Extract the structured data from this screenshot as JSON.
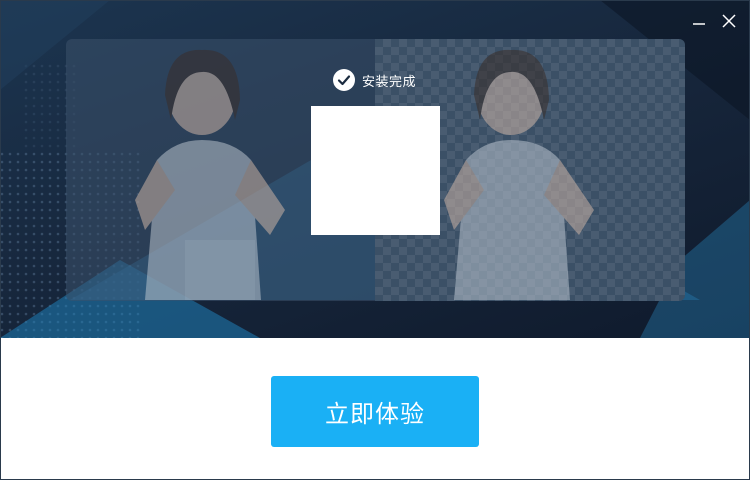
{
  "window": {
    "minimize_icon": "minimize-icon",
    "close_icon": "close-icon"
  },
  "status": {
    "text": "安装完成",
    "icon": "check-circle-icon"
  },
  "preview": {
    "left_label": "original-photo",
    "right_label": "cutout-transparent-background"
  },
  "footer": {
    "button_label": "立即体验"
  },
  "colors": {
    "banner_bg": "#16253a",
    "accent": "#1ab0f5",
    "deco_blue": "#1f7fb8"
  }
}
